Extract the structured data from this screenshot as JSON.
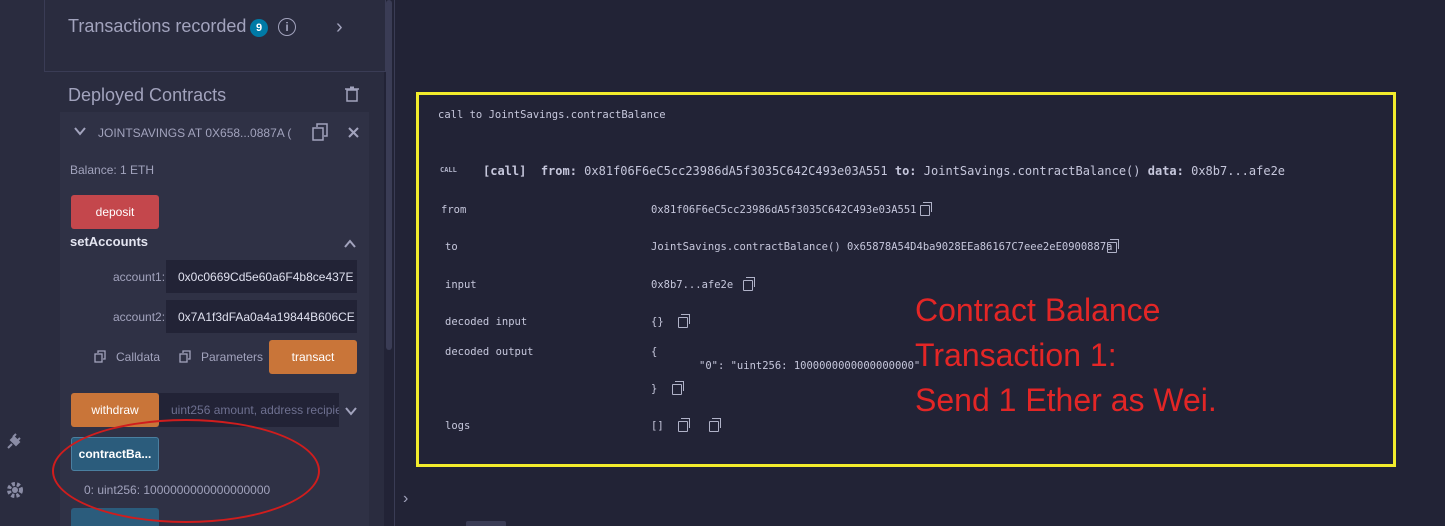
{
  "transactions": {
    "title": "Transactions recorded",
    "count": "9",
    "info_glyph": "i",
    "chevron": "›"
  },
  "deployed": {
    "title": "Deployed Contracts",
    "contract_name": "JOINTSAVINGS AT 0X658...0887A (",
    "balance": "Balance: 1 ETH",
    "deposit_label": "deposit",
    "set_accounts": {
      "title": "setAccounts",
      "account1_label": "account1:",
      "account1_value": "0x0c0669Cd5e60a6F4b8ce437E",
      "account2_label": "account2:",
      "account2_value": "0x7A1f3dFAa0a4a19844B606CE",
      "calldata_label": "Calldata",
      "parameters_label": "Parameters",
      "transact_label": "transact"
    },
    "withdraw_label": "withdraw",
    "withdraw_placeholder": "uint256 amount, address recipie",
    "contract_balance_label": "contractBa...",
    "contract_balance_result": "0: uint256: 1000000000000000000"
  },
  "log": {
    "header": "call to JointSavings.contractBalance",
    "call_tag": "CALL",
    "call_line": {
      "kind": "[call]",
      "from_key": "from:",
      "from_val": "0x81f06F6eC5cc23986dA5f3035C642C493e03A551",
      "to_key": "to:",
      "to_val": "JointSavings.contractBalance()",
      "data_key": "data:",
      "data_val": "0x8b7...afe2e"
    },
    "rows": {
      "from_label": "from",
      "from_value": "0x81f06F6eC5cc23986dA5f3035C642C493e03A551",
      "to_label": "to",
      "to_value": "JointSavings.contractBalance() 0x65878A54D4ba9028EEa86167C7eee2eE0900887a",
      "input_label": "input",
      "input_value": "0x8b7...afe2e",
      "decoded_input_label": "decoded input",
      "decoded_input_value": "{}",
      "decoded_output_label": "decoded output",
      "decoded_output_open": "{",
      "decoded_output_body": "\"0\": \"uint256: 1000000000000000000\"",
      "decoded_output_close": "}",
      "logs_label": "logs",
      "logs_value": "[]"
    }
  },
  "annotation": {
    "line1": "Contract Balance",
    "line2": "Transaction 1:",
    "line3": "Send 1 Ether as Wei."
  },
  "terminal_prompt": "›",
  "colors": {
    "accent_red": "#c4474c",
    "accent_orange": "#c97539",
    "accent_blue": "#2b5c7c",
    "highlight_yellow": "#f2ec2c",
    "annotation_red": "#e32626"
  }
}
